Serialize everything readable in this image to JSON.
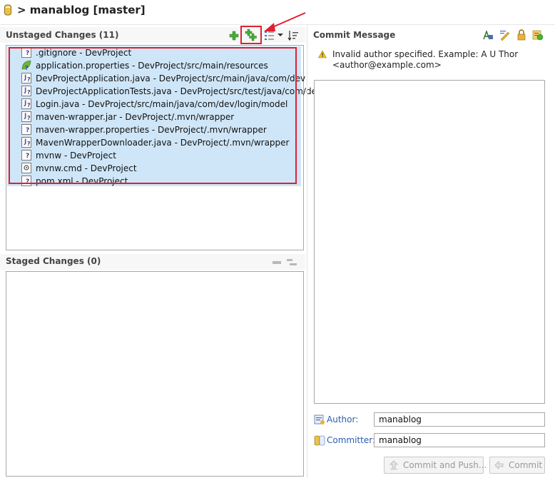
{
  "title": "> manablog [master]",
  "unstaged": {
    "header": "Unstaged Changes (11)",
    "files": [
      {
        "label": ".gitignore - DevProject",
        "icon": "text-file-icon"
      },
      {
        "label": "application.properties - DevProject/src/main/resources",
        "icon": "spring-properties-icon"
      },
      {
        "label": "DevProjectApplication.java - DevProject/src/main/java/com/dev",
        "icon": "java-file-icon"
      },
      {
        "label": "DevProjectApplicationTests.java - DevProject/src/test/java/com/dev",
        "icon": "java-file-icon"
      },
      {
        "label": "Login.java - DevProject/src/main/java/com/dev/login/model",
        "icon": "java-file-icon"
      },
      {
        "label": "maven-wrapper.jar - DevProject/.mvn/wrapper",
        "icon": "jar-file-icon"
      },
      {
        "label": "maven-wrapper.properties - DevProject/.mvn/wrapper",
        "icon": "text-file-icon"
      },
      {
        "label": "MavenWrapperDownloader.java - DevProject/.mvn/wrapper",
        "icon": "java-file-icon"
      },
      {
        "label": "mvnw - DevProject",
        "icon": "text-file-icon"
      },
      {
        "label": "mvnw.cmd - DevProject",
        "icon": "cmd-file-icon"
      },
      {
        "label": "pom.xml - DevProject",
        "icon": "text-file-icon"
      }
    ]
  },
  "staged": {
    "header": "Staged Changes (0)"
  },
  "commit": {
    "header": "Commit Message",
    "warning": "Invalid author specified. Example: A U Thor",
    "warning_line2": "<author@example.com>",
    "author_label": "Author:",
    "author_value": "manablog",
    "committer_label": "Committer:",
    "committer_value": "manablog",
    "commit_push_label": "Commit and Push...",
    "commit_label": "Commit"
  },
  "colors": {
    "selection": "#cfe6f8",
    "highlight": "#e02030",
    "link": "#2a5db0"
  }
}
